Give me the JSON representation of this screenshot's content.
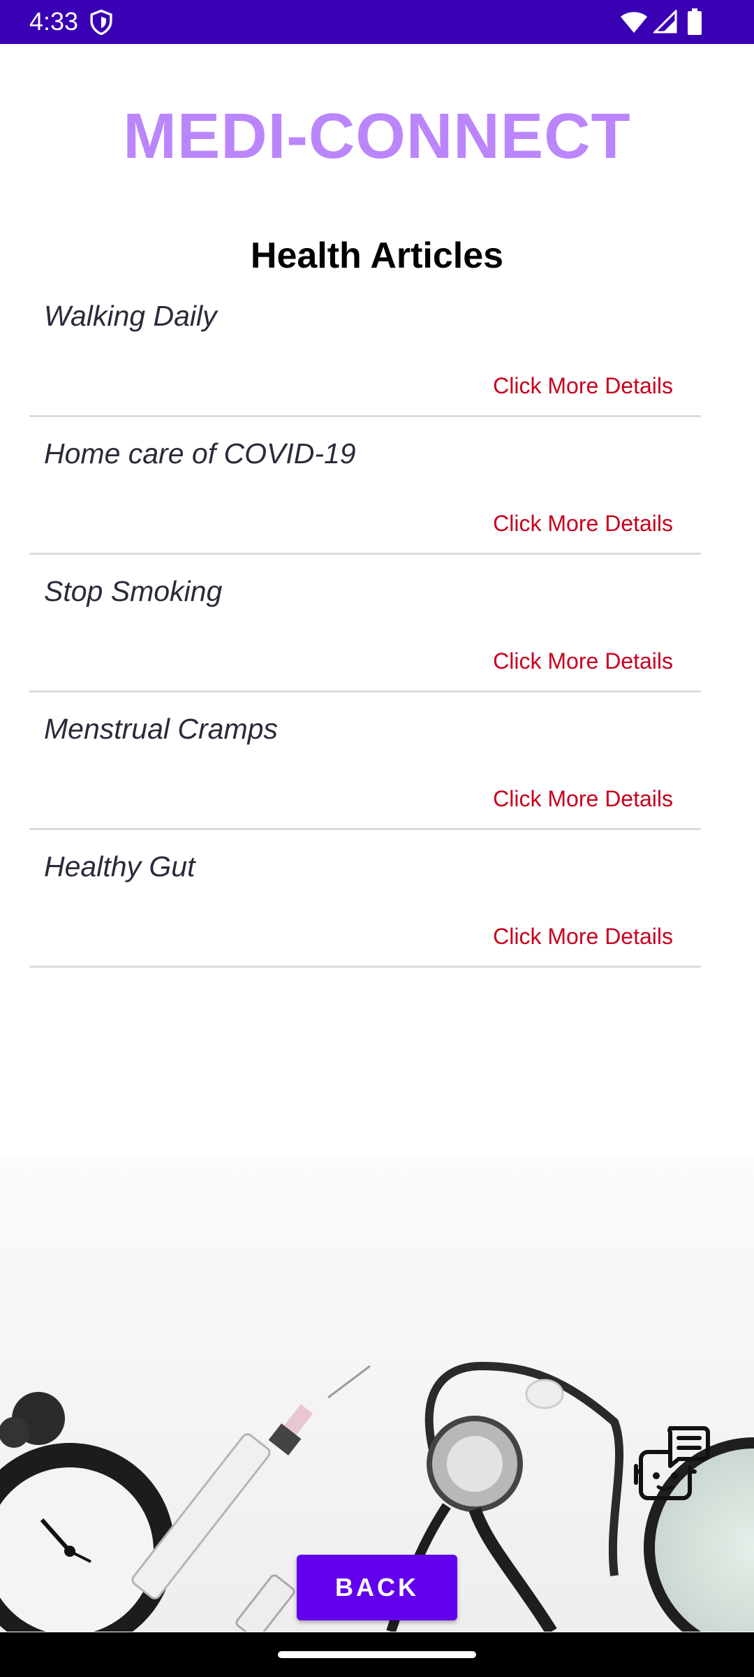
{
  "status_bar": {
    "time": "4:33",
    "icons": [
      "shield-icon",
      "wifi-icon",
      "signal-icon",
      "battery-icon"
    ],
    "background": "#3a00b4"
  },
  "header": {
    "app_title": "MEDI-CONNECT",
    "section_title": "Health Articles",
    "title_color": "#bb86fc"
  },
  "articles": [
    {
      "title": "Walking Daily",
      "link": "Click More Details"
    },
    {
      "title": "Home care of COVID-19",
      "link": "Click More Details"
    },
    {
      "title": "Stop Smoking",
      "link": "Click More Details"
    },
    {
      "title": "Menstrual Cramps",
      "link": "Click More Details"
    },
    {
      "title": "Healthy Gut",
      "link": "Click More Details"
    }
  ],
  "colors": {
    "link": "#c8001e",
    "button": "#6200ee"
  },
  "chatbot": {
    "icon": "chatbot-icon"
  },
  "footer": {
    "back_label": "BACK"
  }
}
